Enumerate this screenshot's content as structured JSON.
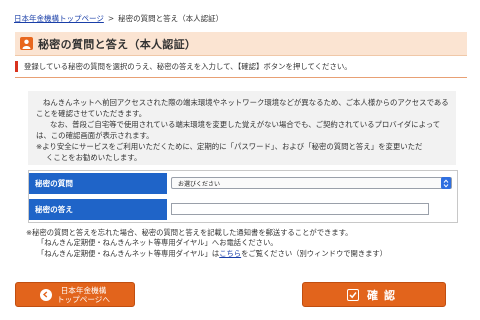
{
  "breadcrumb": {
    "home_link": "日本年金機構トップページ",
    "separator": ">",
    "current": "秘密の質問と答え（本人認証）"
  },
  "page_title": "秘密の質問と答え（本人認証）",
  "instruction": "登録している秘密の質問を選択のうえ、秘密の答えを入力して、【確認】ボタンを押してください。",
  "notice": {
    "p1": "ねんきんネットへ前回アクセスされた際の端末環境やネットワーク環境などが異なるため、ご本人様からのアクセスであることを確認させていただきます。",
    "p2": "なお、普段ご自宅等で使用されている端末環境を変更した覚えがない場合でも、ご契約されているプロバイダによっては、この確認画面が表示されます。",
    "p3_first": "※より安全にサービスをご利用いただくために、定期的に「パスワード」、および「秘密の質問と答え」を変更いただ",
    "p3_cont": "くことをお勧めいたします。"
  },
  "form": {
    "question_label": "秘密の質問",
    "question_selected": "お選びください",
    "answer_label": "秘密の答え",
    "answer_value": ""
  },
  "footnote": {
    "line1": "※秘密の質問と答えを忘れた場合、秘密の質問と答えを記載した通知書を郵送することができます。",
    "line2": "「ねんきん定期便・ねんきんネット等専用ダイヤル」へお電話ください。",
    "line3_before": "「ねんきん定期便・ねんきんネット等専用ダイヤル」は",
    "line3_link": "こちら",
    "line3_after": "をご覧ください（別ウィンドウで開きます）"
  },
  "buttons": {
    "top_line1": "日本年金機構",
    "top_line2": "トップページへ",
    "confirm": "確認"
  },
  "colors": {
    "accent_orange": "#e2641c",
    "form_label_blue": "#1f64c8",
    "title_bg": "#fbe4d2",
    "link_blue": "#1a3fa8",
    "notice_bar_red": "#d8321e"
  }
}
